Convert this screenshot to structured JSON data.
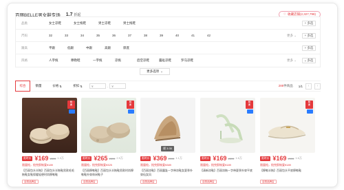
{
  "header": {
    "store_title": "百丽BELLE男女鞋专场",
    "rating": "1.7",
    "rating_unit": "折起",
    "favorite_label": "收藏店铺(2,327,798)"
  },
  "filters": [
    {
      "label": "品类",
      "options": [
        "女士凉鞋",
        "女士拖鞋",
        "男士凉鞋",
        "男士拖鞋"
      ],
      "more": "",
      "multi": "多选"
    },
    {
      "label": "尺码",
      "options": [
        "32",
        "33",
        "34",
        "35",
        "36",
        "37",
        "38",
        "39",
        "40",
        "41",
        "42"
      ],
      "more": "更多",
      "multi": "多选"
    },
    {
      "label": "跟高",
      "options": [
        "平跟",
        "低跟",
        "中跟",
        "高跟",
        "厚底"
      ],
      "more": "",
      "multi": "多选"
    },
    {
      "label": "风格",
      "options": [
        "人字拖",
        "穆勒鞋",
        "一字拖",
        "凉拖",
        "后空凉鞋",
        "露趾凉鞋",
        "罗马凉鞋"
      ],
      "more": "更多",
      "multi": "多选"
    }
  ],
  "more_options": "更多选项",
  "sort": {
    "tabs": [
      "综合",
      "销量",
      "价格",
      "折扣"
    ],
    "price_from": "¥",
    "price_to": "¥",
    "count_number": "288",
    "count_suffix": "件商品",
    "page": "1/1"
  },
  "products": [
    {
      "tag": "限时价",
      "price": "¥169",
      "orig": "¥899",
      "sales": "1.3万",
      "promo": "限量抢，抢完即恢复¥189",
      "desc": "【百丽包头半拖】百丽包头半拖鞋男款毛毛拖鞋女鞋保暖轻便时尚穆勒鞋",
      "shop": "百丽品牌店"
    },
    {
      "tag": "限时价",
      "price": "¥265",
      "orig": "¥899",
      "sales": "2.9万",
      "promo": "限量抢，抢完即恢复¥325",
      "desc": "【百丽穆勒鞋】百丽包头半拖鞋男款时尚穆勒鞋外穿休闲鞋子",
      "shop": "百丽品牌店"
    },
    {
      "tag": "限时价",
      "price": "¥369",
      "orig": "¥999",
      "sales": "1.1万",
      "promo": "限量抢，抢完即恢复¥389",
      "desc": "【百丽凉鞋】百丽露趾一字带凉鞋女夏季外穿仙女风",
      "shop": "百丽品牌店"
    },
    {
      "tag": "限时价",
      "price": "¥169",
      "orig": "¥899",
      "sales": "1.6万",
      "promo": "限量抢，抢完即恢复¥189",
      "desc": "【清新凉鞋】百丽凉拖一字带夏季外穿平底",
      "shop": "百丽品牌店"
    },
    {
      "tag": "限时价",
      "price": "¥169",
      "orig": "¥999",
      "sales": "1.6万",
      "promo": "限量抢，抢完即恢复¥189",
      "desc": "【穆勒半拖】百丽包头平底穆勒鞋",
      "shop": "百丽品牌店"
    }
  ],
  "video_badge": "视 3:35"
}
